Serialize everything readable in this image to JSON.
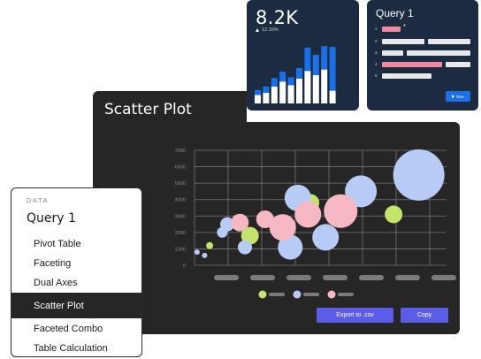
{
  "kpi": {
    "value": "8.2K",
    "delta": "12.16%",
    "bars": [
      {
        "base": 0.12,
        "top": 0.07
      },
      {
        "base": 0.15,
        "top": 0.09
      },
      {
        "base": 0.24,
        "top": 0.12
      },
      {
        "base": 0.31,
        "top": 0.14
      },
      {
        "base": 0.26,
        "top": 0.11
      },
      {
        "base": 0.35,
        "top": 0.15
      },
      {
        "base": 0.46,
        "top": 0.33
      },
      {
        "base": 0.4,
        "top": 0.29
      },
      {
        "base": 0.48,
        "top": 0.33
      },
      {
        "base": 0.18,
        "top": 0.62
      }
    ],
    "colors": {
      "base": "#ffffff",
      "top": "#1d6fe6"
    }
  },
  "query_card": {
    "title": "Query 1",
    "lines": [
      "1",
      "2",
      "3",
      "4",
      "5"
    ],
    "run_label": "Run"
  },
  "scatter": {
    "title": "Scatter Plot",
    "export_label": "Export to .csv",
    "copy_label": "Copy"
  },
  "chart_data": {
    "type": "scatter",
    "y_ticks": [
      "0",
      "1000",
      "2000",
      "3000",
      "4000",
      "5000",
      "6000",
      "7000"
    ],
    "ylim": [
      0,
      7000
    ],
    "xlim": [
      0,
      10
    ],
    "grid": true,
    "series": [
      {
        "color": "#c3e36b",
        "points": [
          {
            "x": 0.6,
            "y": 1200,
            "r": 4
          },
          {
            "x": 2.2,
            "y": 1800,
            "r": 10
          },
          {
            "x": 4.6,
            "y": 3800,
            "r": 10
          },
          {
            "x": 7.9,
            "y": 3100,
            "r": 10
          }
        ]
      },
      {
        "color": "#b7cbf7",
        "points": [
          {
            "x": 0.1,
            "y": 800,
            "r": 3
          },
          {
            "x": 0.4,
            "y": 600,
            "r": 3
          },
          {
            "x": 1.1,
            "y": 2000,
            "r": 6
          },
          {
            "x": 1.3,
            "y": 2500,
            "r": 8
          },
          {
            "x": 2.0,
            "y": 1100,
            "r": 8
          },
          {
            "x": 3.8,
            "y": 1100,
            "r": 14
          },
          {
            "x": 4.1,
            "y": 4100,
            "r": 15
          },
          {
            "x": 5.2,
            "y": 1700,
            "r": 15
          },
          {
            "x": 6.6,
            "y": 4500,
            "r": 18
          },
          {
            "x": 8.9,
            "y": 5500,
            "r": 29
          }
        ]
      },
      {
        "color": "#f6b8c3",
        "points": [
          {
            "x": 1.8,
            "y": 2600,
            "r": 10
          },
          {
            "x": 2.8,
            "y": 2800,
            "r": 10
          },
          {
            "x": 3.5,
            "y": 2300,
            "r": 15
          },
          {
            "x": 4.5,
            "y": 3100,
            "r": 15
          },
          {
            "x": 5.8,
            "y": 3300,
            "r": 19
          }
        ]
      }
    ],
    "legend_colors": [
      "#c3e36b",
      "#b7cbf7",
      "#f6b8c3"
    ]
  },
  "menu": {
    "section_label": "DATA",
    "title": "Query 1",
    "items": [
      "Pivot Table",
      "Faceting",
      "Dual Axes",
      "Scatter Plot",
      "Faceted Combo",
      "Table Calculation"
    ],
    "active_index": 3
  }
}
